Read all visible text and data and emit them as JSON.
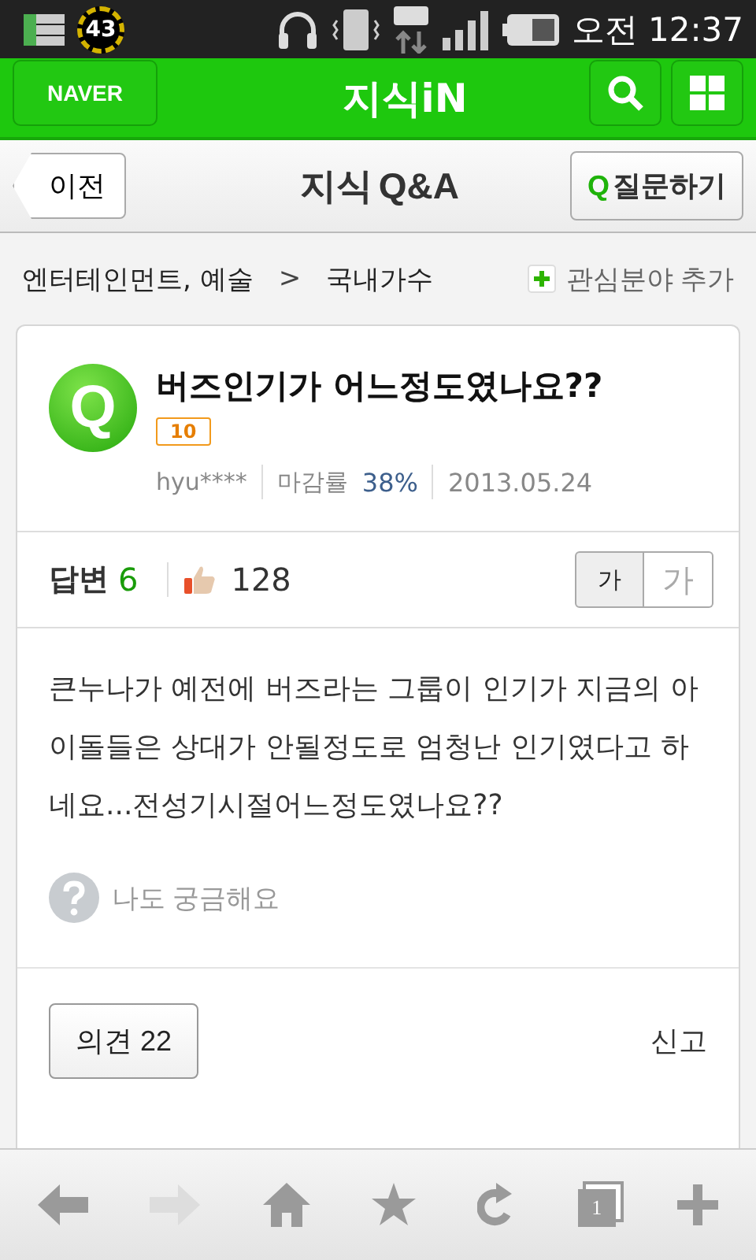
{
  "status_bar": {
    "badge": "43",
    "time": "오전 12:37"
  },
  "header": {
    "logo": "NAVER",
    "title": "지식iN"
  },
  "nav": {
    "back": "이전",
    "title_main": "지식",
    "title_sub": "Q&A",
    "ask_mark": "Q",
    "ask": "질문하기"
  },
  "breadcrumb": {
    "items": [
      "엔터테인먼트, 예술",
      "국내가수"
    ],
    "separator": ">",
    "add_interest": "관심분야 추가"
  },
  "question": {
    "mark": "Q",
    "title": "버즈인기가 어느정도였나요??",
    "points": "10",
    "author": "hyu****",
    "closing_label": "마감률",
    "closing_rate": "38%",
    "date": "2013.05.24"
  },
  "answers": {
    "label": "답변",
    "count": "6",
    "likes": "128"
  },
  "font_sizes": [
    {
      "label": "가",
      "selected": true
    },
    {
      "label": "가",
      "selected": false
    }
  ],
  "body": "큰누나가 예전에 버즈라는 그룹이 인기가 지금의 아이돌들은 상대가 안될정도로 엄청난 인기였다고 하네요...전성기시절어느정도였나요??",
  "curious": "나도 궁금해요",
  "opinion": "의견 22",
  "report": "신고",
  "toolbar": [
    {
      "kind": "back",
      "disabled": false
    },
    {
      "kind": "forward",
      "disabled": true
    },
    {
      "kind": "home",
      "disabled": false
    },
    {
      "kind": "bookmark",
      "disabled": false
    },
    {
      "kind": "reload",
      "disabled": false
    },
    {
      "kind": "tabs",
      "disabled": false,
      "count": "1"
    },
    {
      "kind": "add",
      "disabled": false
    }
  ]
}
